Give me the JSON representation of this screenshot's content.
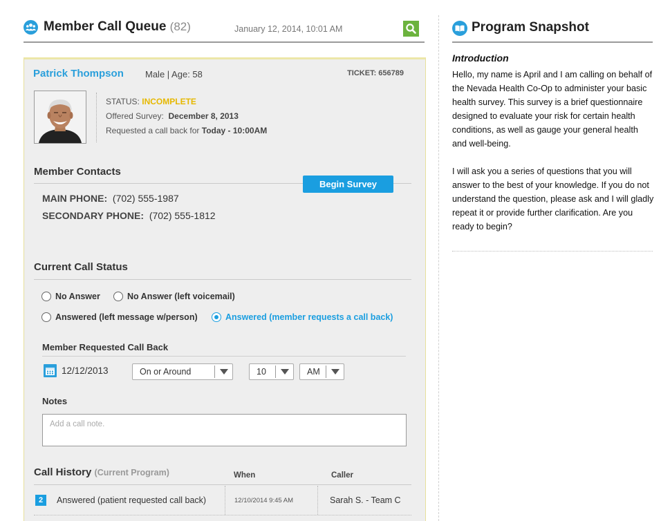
{
  "header": {
    "title": "Member Call Queue",
    "count": "(82)",
    "datetime": "January 12, 2014, 10:01 AM",
    "icons": {
      "people": "people-group-icon",
      "search": "search-icon"
    },
    "accent": "#2a9fdb",
    "search_color": "#6cb33e"
  },
  "snapshot": {
    "title": "Program Snapshot",
    "icon": "open-book-icon",
    "intro_heading": "Introduction",
    "paragraphs": [
      "Hello, my name is April and I am calling on behalf of the Nevada Health Co-Op to administer your basic health survey. This survey is a brief questionnaire designed to evaluate your risk for certain health conditions, as well as gauge your general health and well-being.",
      "I will ask you a series of questions that you will answer to the best of your knowledge. If you do not understand the question, please ask and I will gladly repeat it or provide further clarification. Are you ready to begin?"
    ]
  },
  "member": {
    "name": "Patrick Thompson",
    "info": "Male | Age: 58",
    "ticket": "TICKET: 656789",
    "status_label": "STATUS:",
    "status_value": "INCOMPLETE",
    "status_color": "#e6b800",
    "offered_label": "Offered Survey:",
    "offered_value": "December 8, 2013",
    "callback_label": "Requested a call back for",
    "callback_value": "Today - 10:00AM"
  },
  "contacts": {
    "title": "Member Contacts",
    "begin_button": "Begin Survey",
    "main_label": "MAIN PHONE:",
    "main_value": "(702) 555-1987",
    "secondary_label": "SECONDARY PHONE:",
    "secondary_value": "(702) 555-1812"
  },
  "call_status": {
    "title": "Current Call Status",
    "options": [
      {
        "label": "No Answer",
        "selected": false
      },
      {
        "label": "No Answer (left voicemail)",
        "selected": false
      },
      {
        "label": "Answered (left message w/person)",
        "selected": false
      },
      {
        "label": "Answered (member requests a call back)",
        "selected": true
      }
    ]
  },
  "callback": {
    "title": "Member Requested Call Back",
    "date": "12/12/2013",
    "calendar_icon": "calendar-icon",
    "timing": "On or Around",
    "hour": "10",
    "ampm": "AM"
  },
  "notes": {
    "title": "Notes",
    "placeholder": "Add a call note."
  },
  "history": {
    "title": "Call History",
    "subtitle": "(Current Program)",
    "columns": {
      "when": "When",
      "caller": "Caller"
    },
    "rows": [
      {
        "num": "2",
        "status": "Answered (patient requested call back)",
        "when": "12/10/2014  9:45 AM",
        "caller": "Sarah S. - Team C"
      }
    ]
  }
}
